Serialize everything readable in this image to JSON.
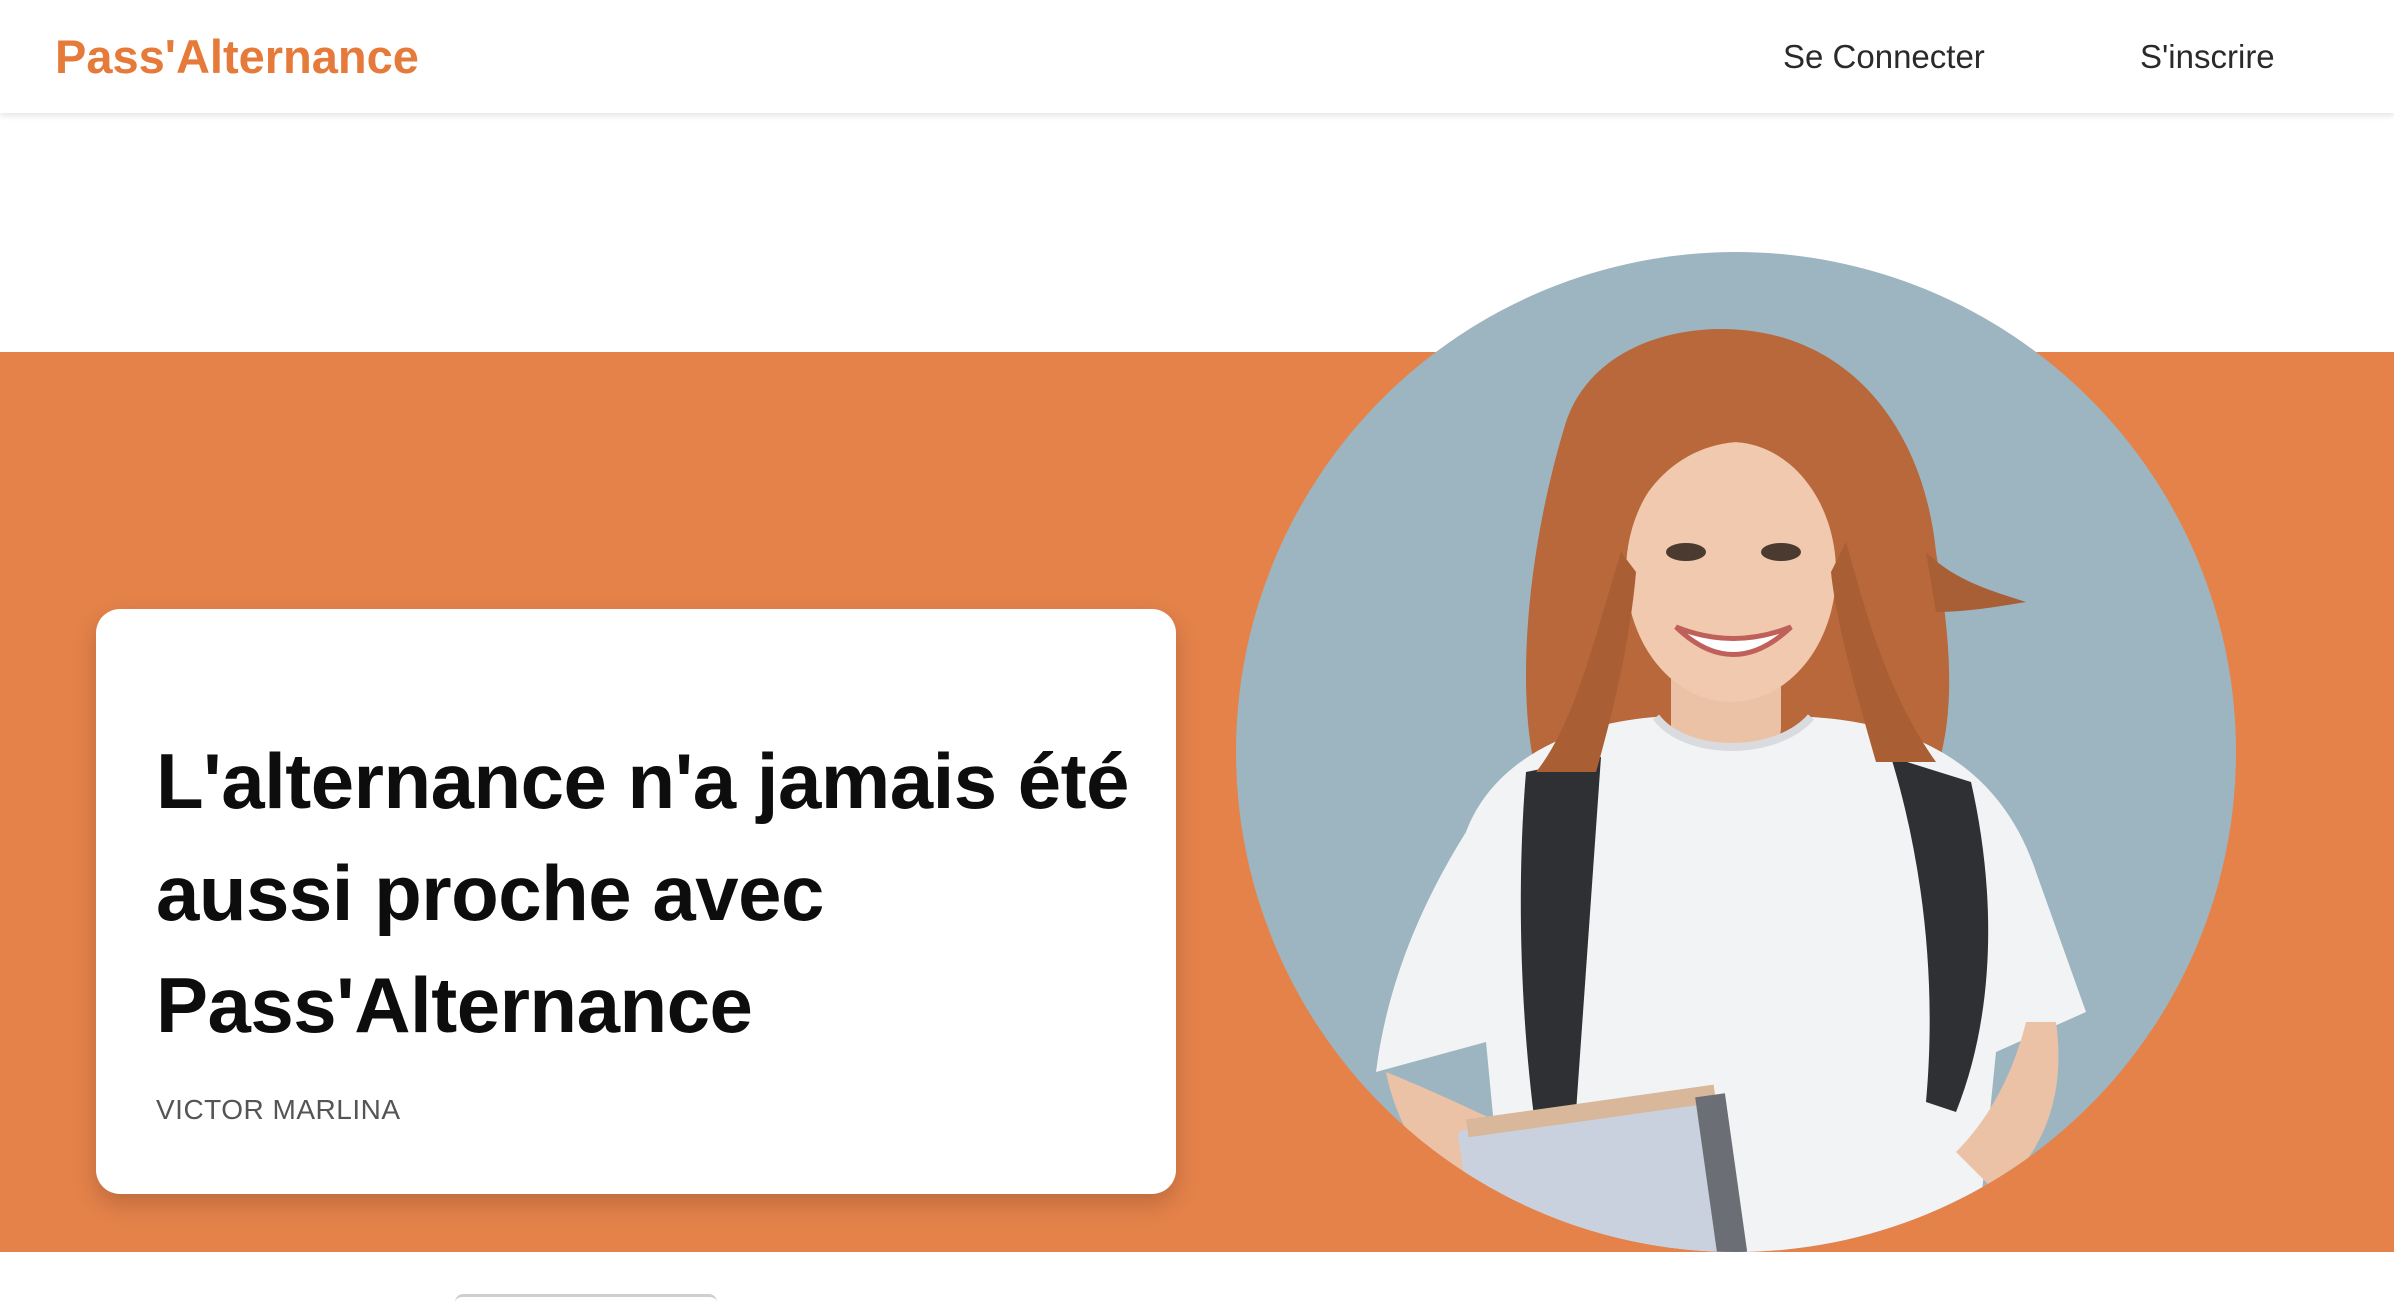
{
  "colors": {
    "accent": "#E5824A",
    "brand_text": "#E57A3A",
    "photo_background": "#9DB5C0"
  },
  "navbar": {
    "brand": "Pass'Alternance",
    "login_label": "Se Connecter",
    "signup_label": "S'inscrire"
  },
  "hero": {
    "title": "L'alternance n'a jamais été aussi proche avec Pass'Alternance",
    "author": "VICTOR MARLINA"
  }
}
